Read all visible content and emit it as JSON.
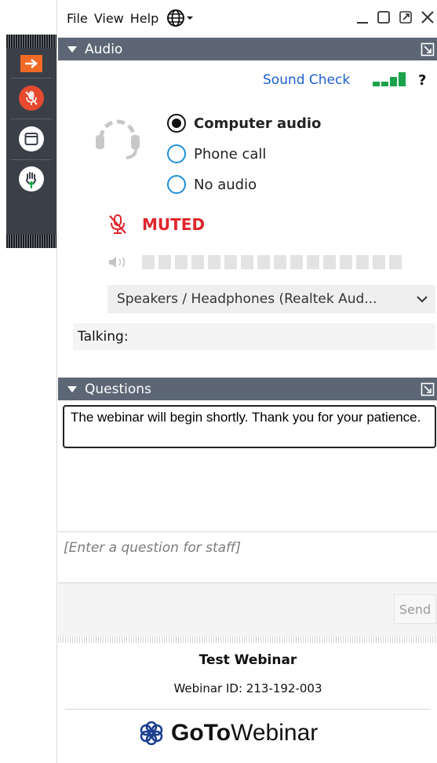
{
  "menubar": {
    "file": "File",
    "view": "View",
    "help": "Help"
  },
  "audio": {
    "header": "Audio",
    "sound_check": "Sound Check",
    "help_mark": "?",
    "options": [
      {
        "label": "Computer audio",
        "selected": true
      },
      {
        "label": "Phone call",
        "selected": false
      },
      {
        "label": "No audio",
        "selected": false
      }
    ],
    "status": "MUTED",
    "speaker_device": "Speakers / Headphones (Realtek Aud...",
    "talking_label": "Talking:"
  },
  "questions": {
    "header": "Questions",
    "message": "The webinar will begin shortly.  Thank you for your patience.",
    "input_placeholder": "[Enter a question for staff]",
    "send_label": "Send"
  },
  "footer": {
    "webinar_title": "Test Webinar",
    "webinar_id": "Webinar ID: 213-192-003",
    "logo_bold": "GoTo",
    "logo_regular": "Webinar"
  },
  "colors": {
    "panel_header": "#5c6674",
    "muted_red": "#e0242b",
    "link_blue": "#1d5fd1",
    "signal_green": "#1aa34a",
    "control_strip": "#3a3f48",
    "accent_orange": "#f06a26"
  },
  "icons": {
    "strip": [
      "arrow-right-icon",
      "mic-muted-icon",
      "window-icon",
      "raise-hand-icon"
    ],
    "menubar": [
      "globe-icon",
      "minimize-icon",
      "restore-icon",
      "popout-icon",
      "close-icon"
    ]
  }
}
